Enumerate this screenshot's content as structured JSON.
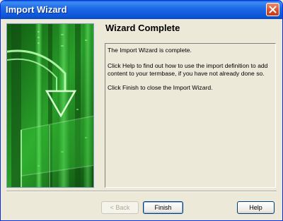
{
  "window": {
    "title": "Import Wizard",
    "close_icon": "close-icon"
  },
  "heading": "Wizard Complete",
  "message": {
    "line1": "The Import Wizard is complete.",
    "line2": "Click Help to find out how to use the import definition to add content to your termbase, if you have not already done so.",
    "line3": "Click Finish to close the Import Wizard."
  },
  "buttons": {
    "back": "< Back",
    "finish": "Finish",
    "help": "Help"
  },
  "colors": {
    "accent": "#0b53d6",
    "art_green": "#3ad63a",
    "close_red": "#d8502c"
  }
}
